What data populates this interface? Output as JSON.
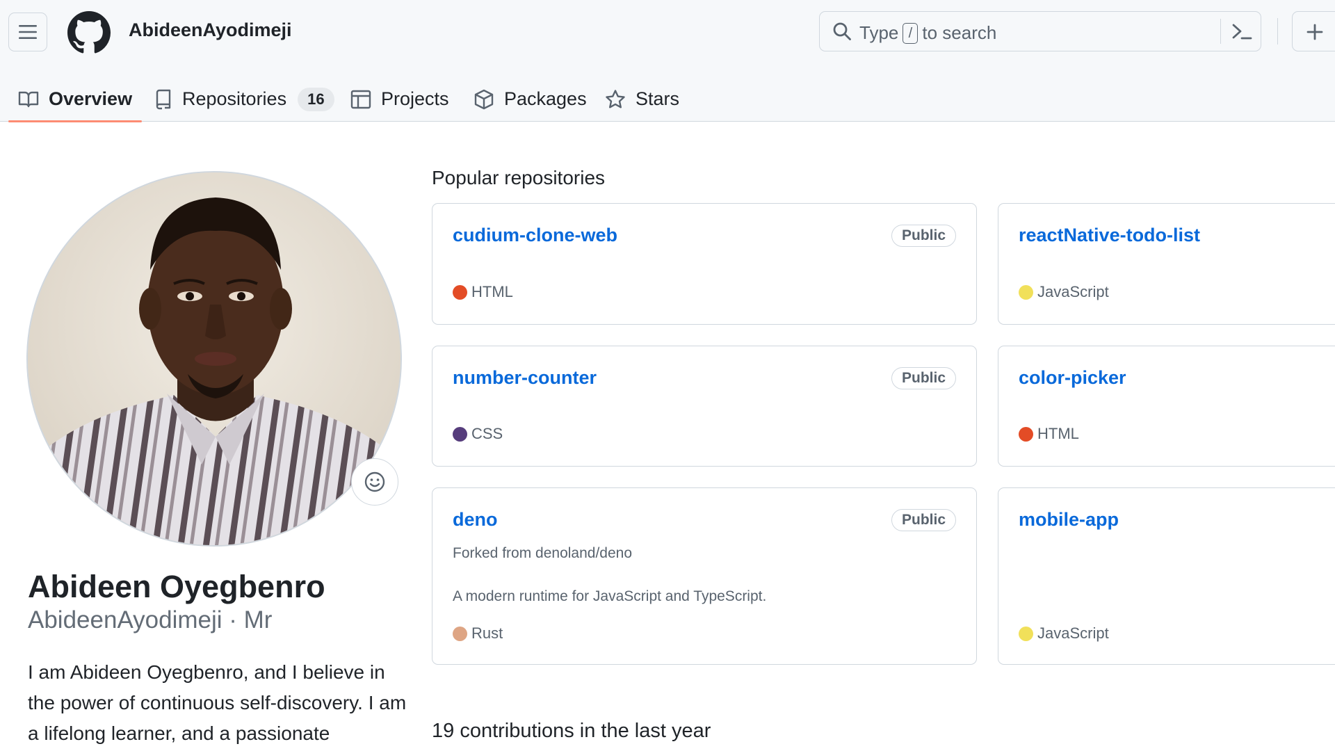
{
  "header": {
    "username": "AbideenAyodimeji",
    "search": {
      "prefix": "Type",
      "key": "/",
      "suffix": "to search"
    }
  },
  "tabs": [
    {
      "label": "Overview",
      "icon": "book-icon",
      "active": true
    },
    {
      "label": "Repositories",
      "icon": "repo-icon",
      "count": "16"
    },
    {
      "label": "Projects",
      "icon": "table-icon"
    },
    {
      "label": "Packages",
      "icon": "package-icon"
    },
    {
      "label": "Stars",
      "icon": "star-icon"
    }
  ],
  "profile": {
    "full_name": "Abideen Oyegbenro",
    "login_line": "AbideenAyodimeji · Mr",
    "bio": "I am Abideen Oyegbenro, and I believe in the power of continuous self-discovery. I am a lifelong learner, and a passionate"
  },
  "popular": {
    "title": "Popular repositories",
    "repos": [
      {
        "name": "cudium-clone-web",
        "badge": "Public",
        "language": "HTML",
        "lang_color": "#e34c26"
      },
      {
        "name": "reactNative-todo-list",
        "badge": "",
        "language": "JavaScript",
        "lang_color": "#f1e05a"
      },
      {
        "name": "number-counter",
        "badge": "Public",
        "language": "CSS",
        "lang_color": "#563d7c"
      },
      {
        "name": "color-picker",
        "badge": "",
        "language": "HTML",
        "lang_color": "#e34c26"
      },
      {
        "name": "deno",
        "badge": "Public",
        "forked": "Forked from denoland/deno",
        "description": "A modern runtime for JavaScript and TypeScript.",
        "language": "Rust",
        "lang_color": "#dea584"
      },
      {
        "name": "mobile-app",
        "badge": "",
        "language": "JavaScript",
        "lang_color": "#f1e05a"
      }
    ]
  },
  "contributions": {
    "text": "19 contributions in the last year"
  },
  "colors": {
    "link": "#0969da",
    "tab_underline": "#fd8c73",
    "muted": "#59636e"
  }
}
